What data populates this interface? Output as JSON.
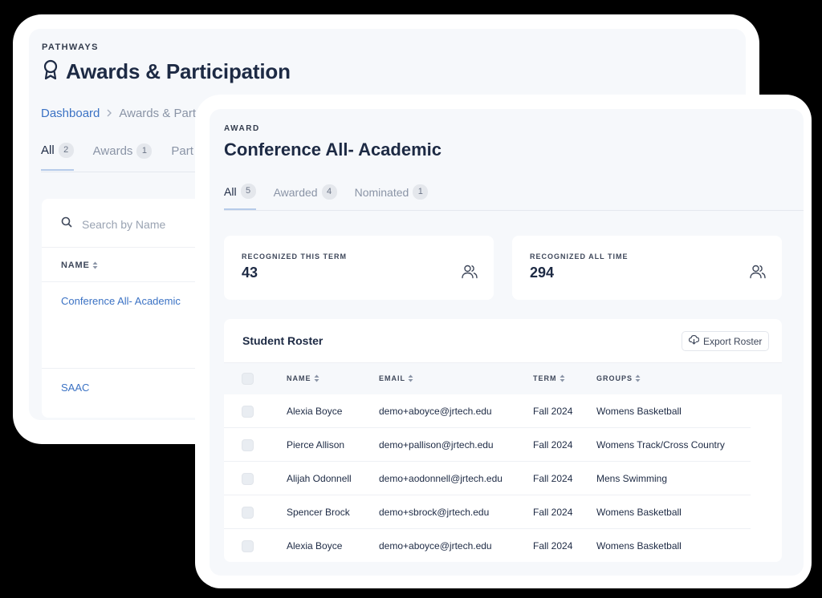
{
  "back": {
    "eyebrow": "PATHWAYS",
    "title": "Awards & Participation",
    "breadcrumb": {
      "home": "Dashboard",
      "current": "Awards & Part"
    },
    "tabs": [
      {
        "label": "All",
        "count": "2"
      },
      {
        "label": "Awards",
        "count": "1"
      },
      {
        "label": "Part",
        "count": ""
      }
    ],
    "search": {
      "placeholder": "Search by Name"
    },
    "table": {
      "column": "NAME",
      "rows": [
        "Conference All- Academic",
        "SAAC"
      ]
    }
  },
  "award": {
    "eyebrow": "AWARD",
    "title": "Conference All- Academic",
    "tabs": [
      {
        "label": "All",
        "count": "5"
      },
      {
        "label": "Awarded",
        "count": "4"
      },
      {
        "label": "Nominated",
        "count": "1"
      }
    ],
    "stats": [
      {
        "label": "RECOGNIZED THIS TERM",
        "value": "43",
        "icon": "users-icon"
      },
      {
        "label": "RECOGNIZED ALL TIME",
        "value": "294",
        "icon": "users-icon"
      }
    ]
  },
  "roster": {
    "title": "Student Roster",
    "export_label": "Export Roster",
    "columns": [
      "NAME",
      "EMAIL",
      "TERM",
      "GROUPS"
    ],
    "rows": [
      {
        "name": "Alexia Boyce",
        "email": "demo+aboyce@jrtech.edu",
        "term": "Fall 2024",
        "groups": "Womens Basketball"
      },
      {
        "name": "Pierce Allison",
        "email": "demo+pallison@jrtech.edu",
        "term": "Fall 2024",
        "groups": "Womens Track/Cross Country"
      },
      {
        "name": "Alijah Odonnell",
        "email": "demo+aodonnell@jrtech.edu",
        "term": "Fall 2024",
        "groups": "Mens Swimming"
      },
      {
        "name": "Spencer Brock",
        "email": "demo+sbrock@jrtech.edu",
        "term": "Fall 2024",
        "groups": "Womens Basketball"
      },
      {
        "name": "Alexia Boyce",
        "email": "demo+aboyce@jrtech.edu",
        "term": "Fall 2024",
        "groups": "Womens Basketball"
      }
    ]
  }
}
